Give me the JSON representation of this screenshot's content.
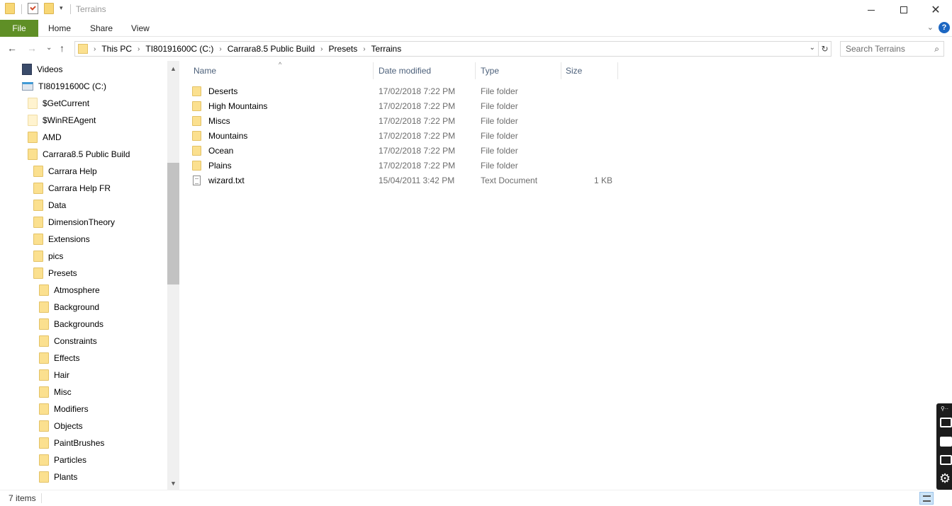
{
  "window": {
    "title": "Terrains",
    "minimize_icon": "minimize-icon",
    "maximize_icon": "maximize-icon",
    "close_icon": "close-icon"
  },
  "ribbon": {
    "tabs": [
      "File",
      "Home",
      "Share",
      "View"
    ],
    "help_label": "?"
  },
  "address": {
    "crumbs": [
      "This PC",
      "TI80191600C (C:)",
      "Carrara8.5 Public Build",
      "Presets",
      "Terrains"
    ],
    "search_placeholder": "Search Terrains"
  },
  "nav": {
    "items": [
      {
        "label": "Videos",
        "icon": "video-icon"
      },
      {
        "label": "TI80191600C (C:)",
        "icon": "drive-icon"
      },
      {
        "label": "$GetCurrent",
        "icon": "folder-icon"
      },
      {
        "label": "$WinREAgent",
        "icon": "folder-icon"
      },
      {
        "label": "AMD",
        "icon": "folder-icon"
      },
      {
        "label": "Carrara8.5 Public Build",
        "icon": "folder-icon"
      },
      {
        "label": "Carrara Help",
        "icon": "folder-icon"
      },
      {
        "label": "Carrara Help FR",
        "icon": "folder-icon"
      },
      {
        "label": "Data",
        "icon": "folder-icon"
      },
      {
        "label": "DimensionTheory",
        "icon": "folder-icon"
      },
      {
        "label": "Extensions",
        "icon": "folder-icon"
      },
      {
        "label": "pics",
        "icon": "folder-icon"
      },
      {
        "label": "Presets",
        "icon": "folder-icon"
      },
      {
        "label": "Atmosphere",
        "icon": "folder-icon"
      },
      {
        "label": "Background",
        "icon": "folder-icon"
      },
      {
        "label": "Backgrounds",
        "icon": "folder-icon"
      },
      {
        "label": "Constraints",
        "icon": "folder-icon"
      },
      {
        "label": "Effects",
        "icon": "folder-icon"
      },
      {
        "label": "Hair",
        "icon": "folder-icon"
      },
      {
        "label": "Misc",
        "icon": "folder-icon"
      },
      {
        "label": "Modifiers",
        "icon": "folder-icon"
      },
      {
        "label": "Objects",
        "icon": "folder-icon"
      },
      {
        "label": "PaintBrushes",
        "icon": "folder-icon"
      },
      {
        "label": "Particles",
        "icon": "folder-icon"
      },
      {
        "label": "Plants",
        "icon": "folder-icon"
      }
    ]
  },
  "files": {
    "columns": [
      "Name",
      "Date modified",
      "Type",
      "Size"
    ],
    "rows": [
      {
        "name": "Deserts",
        "date": "17/02/2018 7:22 PM",
        "type": "File folder",
        "size": "",
        "icon": "folder-icon"
      },
      {
        "name": "High Mountains",
        "date": "17/02/2018 7:22 PM",
        "type": "File folder",
        "size": "",
        "icon": "folder-icon"
      },
      {
        "name": "Miscs",
        "date": "17/02/2018 7:22 PM",
        "type": "File folder",
        "size": "",
        "icon": "folder-icon"
      },
      {
        "name": "Mountains",
        "date": "17/02/2018 7:22 PM",
        "type": "File folder",
        "size": "",
        "icon": "folder-icon"
      },
      {
        "name": "Ocean",
        "date": "17/02/2018 7:22 PM",
        "type": "File folder",
        "size": "",
        "icon": "folder-icon"
      },
      {
        "name": "Plains",
        "date": "17/02/2018 7:22 PM",
        "type": "File folder",
        "size": "",
        "icon": "folder-icon"
      },
      {
        "name": "wizard.txt",
        "date": "15/04/2011 3:42 PM",
        "type": "Text Document",
        "size": "1 KB",
        "icon": "text-document-icon"
      }
    ]
  },
  "status": {
    "item_count": "7 items"
  }
}
